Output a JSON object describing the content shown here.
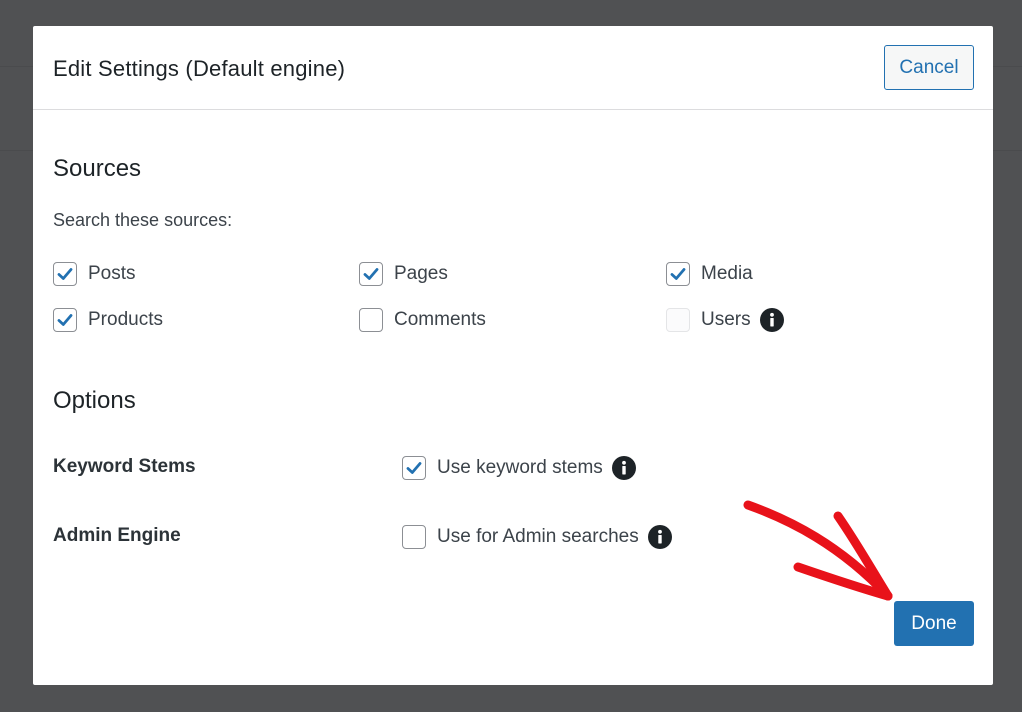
{
  "modal": {
    "title": "Edit Settings (Default engine)",
    "cancel_label": "Cancel",
    "done_label": "Done"
  },
  "sources": {
    "heading": "Sources",
    "subtitle": "Search these sources:",
    "items": [
      {
        "label": "Posts",
        "checked": true
      },
      {
        "label": "Pages",
        "checked": true
      },
      {
        "label": "Media",
        "checked": true
      },
      {
        "label": "Products",
        "checked": true
      },
      {
        "label": "Comments",
        "checked": false
      },
      {
        "label": "Users",
        "checked": false,
        "disabled": true,
        "info": true
      }
    ]
  },
  "options": {
    "heading": "Options",
    "rows": [
      {
        "label": "Keyword Stems",
        "checkbox_label": "Use keyword stems",
        "checked": true
      },
      {
        "label": "Admin Engine",
        "checkbox_label": "Use for Admin searches",
        "checked": false
      }
    ]
  },
  "colors": {
    "accent": "#2271b1",
    "annotation_arrow": "#e8121a"
  },
  "icons": {
    "check": "checkmark-icon",
    "info": "info-icon",
    "annotation": "red-arrow-annotation"
  }
}
